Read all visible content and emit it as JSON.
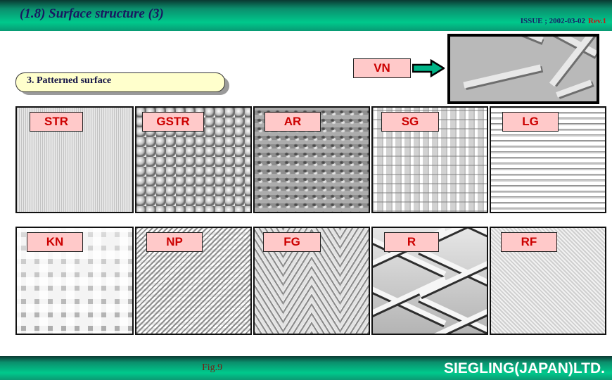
{
  "header": {
    "title": "(1.8) Surface structure  (3)",
    "issue_label": "ISSUE ; 2002-03-02",
    "revision": "Rev.1"
  },
  "callout": {
    "text": "3. Patterned surface"
  },
  "feature": {
    "label": "VN",
    "arrow_icon": "right-arrow-icon",
    "photo_alt": "vn-surface-photo"
  },
  "tiles": [
    {
      "label": "STR",
      "texture": "vertical-fine-stripe"
    },
    {
      "label": "GSTR",
      "texture": "dimple-dot-array"
    },
    {
      "label": "AR",
      "texture": "crescent-emboss"
    },
    {
      "label": "SG",
      "texture": "basket-weave"
    },
    {
      "label": "LG",
      "texture": "horizontal-groove"
    },
    {
      "label": "KN",
      "texture": "raised-cross"
    },
    {
      "label": "NP",
      "texture": "diagonal-dash"
    },
    {
      "label": "FG",
      "texture": "herringbone"
    },
    {
      "label": "R",
      "texture": "diamond-lozenge"
    },
    {
      "label": "RF",
      "texture": "fine-twill"
    }
  ],
  "footer": {
    "figure": "Fig.9",
    "company": "SIEGLING(JAPAN)LTD."
  },
  "colors": {
    "band_green": "#00c98c",
    "title_navy": "#181860",
    "label_pink": "#ffc9c9",
    "label_red": "#cc0000",
    "callout_yellow": "#ffffcc",
    "revision_red": "#cc1414"
  }
}
